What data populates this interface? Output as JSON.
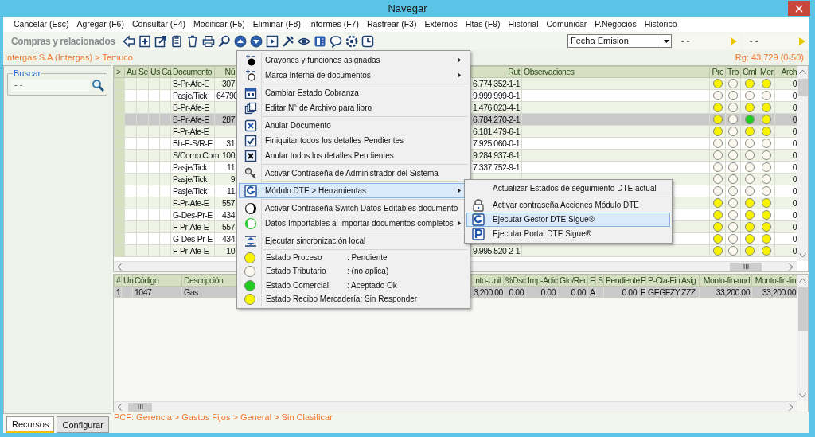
{
  "window": {
    "title": "Navegar"
  },
  "menu_bar": [
    "Cancelar (Esc)",
    "Agregar (F6)",
    "Consultar (F4)",
    "Modificar (F5)",
    "Eliminar (F8)",
    "Informes (F7)",
    "Rastrear (F3)",
    "Externos",
    "Htas (F9)",
    "Historial",
    "Comunicar",
    "P.Negocios",
    "Histórico"
  ],
  "toolbar": {
    "title": "Compras y relacionados",
    "date_field": {
      "value": "Fecha Emision"
    },
    "range_fields": [
      {
        "value": "- -"
      },
      {
        "value": "- -"
      }
    ]
  },
  "breadcrumb": "Intergas S.A (Intergas) > Temuco",
  "record_count": "Rg: 43,729 (0-50)",
  "search": {
    "legend": "Buscar",
    "value": "- -"
  },
  "upper_table": {
    "columns": [
      ">",
      "Au",
      "Se",
      "Us",
      "Ca",
      "Documento",
      "Nú",
      "Rut",
      "Observaciones",
      "Prc",
      "Trb",
      "Cml",
      "Mer",
      "Arch"
    ],
    "rows": [
      {
        "document": "B-Pr-Afe-E",
        "number": "307",
        "rut": "6.774.352-1-1",
        "dots": [
          {
            "color": "#f8f400"
          },
          {
            "color": "#fbf8f0"
          },
          {
            "color": "#f8f400"
          },
          {
            "color": "#f8f400"
          }
        ],
        "arch": "0",
        "selected": false
      },
      {
        "document": "Pasje/Tick",
        "number": "64790",
        "rut": "9.999.999-9-1",
        "dots": [
          {
            "color": "#fbf8f0"
          },
          {
            "color": "#fbf8f0"
          },
          {
            "color": "#fbf8f0"
          },
          {
            "color": "#fbf8f0"
          }
        ],
        "arch": "0",
        "selected": false
      },
      {
        "document": "B-Pr-Afe-E",
        "rut": "1.476.023-4-1",
        "dots": [
          {
            "color": "#f8f400"
          },
          {
            "color": "#fbf8f0"
          },
          {
            "color": "#f8f400"
          },
          {
            "color": "#f8f400"
          }
        ],
        "arch": "0",
        "selected": false
      },
      {
        "document": "B-Pr-Afe-E",
        "number": "287",
        "rut": "6.784.270-2-1",
        "dots": [
          {
            "color": "#f8f400"
          },
          {
            "color": "#fbf8f0"
          },
          {
            "color": "#22cc22"
          },
          {
            "color": "#f8f400"
          }
        ],
        "arch": "0",
        "selected": true
      },
      {
        "document": "F-Pr-Afe-E",
        "rut": "6.181.479-6-1",
        "dots": [
          {
            "color": "#f8f400"
          },
          {
            "color": "#fbf8f0"
          },
          {
            "color": "#f8f400"
          },
          {
            "color": "#f8f400"
          }
        ],
        "arch": "0",
        "selected": false
      },
      {
        "document": "Bh-E-S/R-E",
        "number": "31",
        "rut": "7.925.060-0-1",
        "dots": [
          {
            "color": "#fbf8f0"
          },
          {
            "color": "#fbf8f0"
          },
          {
            "color": "#fbf8f0"
          },
          {
            "color": "#fbf8f0"
          }
        ],
        "arch": "0",
        "selected": false
      },
      {
        "document": "S/Comp Com",
        "number": "100",
        "rut": "9.284.937-6-1",
        "dots": [
          {
            "color": "#fbf8f0"
          },
          {
            "color": "#fbf8f0"
          },
          {
            "color": "#fbf8f0"
          },
          {
            "color": "#fbf8f0"
          }
        ],
        "arch": "0",
        "selected": false
      },
      {
        "document": "Pasje/Tick",
        "number": "11",
        "rut": "7.337.752-9-1",
        "dots": [
          {
            "color": "#fbf8f0"
          },
          {
            "color": "#fbf8f0"
          },
          {
            "color": "#fbf8f0"
          },
          {
            "color": "#fbf8f0"
          }
        ],
        "arch": "0",
        "selected": false
      },
      {
        "document": "Pasje/Tick",
        "number": "9",
        "dots": [
          {
            "color": "#fbf8f0"
          },
          {
            "color": "#fbf8f0"
          },
          {
            "color": "#fbf8f0"
          },
          {
            "color": "#fbf8f0"
          }
        ],
        "arch": "0",
        "selected": false
      },
      {
        "document": "Pasje/Tick",
        "number": "11",
        "dots": [
          {
            "color": "#fbf8f0"
          },
          {
            "color": "#fbf8f0"
          },
          {
            "color": "#fbf8f0"
          },
          {
            "color": "#fbf8f0"
          }
        ],
        "arch": "0",
        "selected": false
      },
      {
        "document": "F-Pr-Afe-E",
        "number": "557",
        "dots": [
          {
            "color": "#f8f400"
          },
          {
            "color": "#fbf8f0"
          },
          {
            "color": "#f8f400"
          },
          {
            "color": "#f8f400"
          }
        ],
        "arch": "0",
        "selected": false
      },
      {
        "document": "G-Des-Pr-E",
        "number": "434",
        "dots": [
          {
            "color": "#f8f400"
          },
          {
            "color": "#fbf8f0"
          },
          {
            "color": "#f8f400"
          },
          {
            "color": "#f8f400"
          }
        ],
        "arch": "0",
        "selected": false
      },
      {
        "document": "F-Pr-Afe-E",
        "number": "557",
        "dots": [
          {
            "color": "#f8f400"
          },
          {
            "color": "#fbf8f0"
          },
          {
            "color": "#f8f400"
          },
          {
            "color": "#f8f400"
          }
        ],
        "arch": "0",
        "selected": false
      },
      {
        "document": "G-Des-Pr-E",
        "number": "434",
        "dots": [
          {
            "color": "#f8f400"
          },
          {
            "color": "#fbf8f0"
          },
          {
            "color": "#f8f400"
          },
          {
            "color": "#f8f400"
          }
        ],
        "arch": "0",
        "selected": false
      },
      {
        "document": "F-Pr-Afe-E",
        "number": "10",
        "rut": "9.995.520-2-1",
        "dots": [
          {
            "color": "#f8f400"
          },
          {
            "color": "#fbf8f0"
          },
          {
            "color": "#f8f400"
          },
          {
            "color": "#f8f400"
          }
        ],
        "arch": "0",
        "selected": false
      }
    ]
  },
  "lower_table": {
    "columns": [
      "#",
      "Un",
      "Código",
      "Descripción",
      "nto-Unit",
      "%Dsc",
      "Imp-Adic",
      "Gto/Rec",
      "E",
      "S",
      "Pendiente",
      "E.",
      "P-Cta-Fin",
      "Asig",
      "Monto-fin-und",
      "Monto-fin-lin"
    ],
    "rows": [
      {
        "cells": [
          "1",
          null,
          "1047",
          "Gas",
          "3,200.00",
          "0.00",
          "0.00",
          "0.00",
          "A",
          null,
          "0.00",
          "F",
          "GEGFZY",
          "ZZZ",
          "33,200.00",
          "33,200.00"
        ],
        "selected": true
      }
    ]
  },
  "pcf_path": "PCF: Gerencia > Gastos Fijos > General > Sin Clasificar",
  "bottom_tabs": [
    {
      "label": "Recursos",
      "selected": true
    },
    {
      "label": "Configurar",
      "selected": false
    }
  ],
  "context_menu": {
    "groups": [
      [
        {
          "label": "Crayones y funciones asignadas",
          "has_submenu": true,
          "selected": false
        },
        {
          "label": "Marca Interna de documentos",
          "has_submenu": true,
          "selected": false
        }
      ],
      [
        {
          "label": "Cambiar Estado Cobranza",
          "has_submenu": false,
          "selected": false
        },
        {
          "label": "Editar N° de Archivo para libro",
          "has_submenu": false,
          "selected": false
        }
      ],
      [
        {
          "label": "Anular Documento",
          "has_submenu": false,
          "selected": false
        },
        {
          "label": "Finiquitar todos los detalles Pendientes",
          "has_submenu": false,
          "selected": false
        },
        {
          "label": "Anular todos los detalles Pendientes",
          "has_submenu": false,
          "selected": false
        }
      ],
      [
        {
          "label": "Activar Contraseña de Administrador del Sistema",
          "has_submenu": false,
          "selected": false
        }
      ],
      [
        {
          "label": "Módulo DTE > Herramientas",
          "has_submenu": true,
          "selected": true
        }
      ],
      [
        {
          "label": "Activar Contraseña Switch Datos Editables documento",
          "has_submenu": false,
          "selected": false
        },
        {
          "label": "Datos Importables al importar documentos completos",
          "has_submenu": true,
          "selected": false
        }
      ],
      [
        {
          "label": "Ejecutar sincronización local",
          "has_submenu": false,
          "selected": false
        }
      ]
    ],
    "statuses": [
      {
        "label": "Estado Proceso",
        "value": ": Pendiente",
        "color": "#f8f400"
      },
      {
        "label": "Estado Tributario",
        "value": ": (no aplica)",
        "color": "#fbf8f0"
      },
      {
        "label": "Estado Comercial",
        "value": ": Aceptado Ok",
        "color": "#22cc22"
      },
      {
        "label": "Estado Recibo Mercadería",
        "value": ": Sin Responder",
        "color": "#f8f400"
      }
    ]
  },
  "submenu": {
    "groups": [
      [
        {
          "label": "Actualizar Estados de seguimiento DTE actual",
          "selected": false
        }
      ],
      [
        {
          "label": "Activar contraseña Acciones Módulo DTE",
          "selected": false
        },
        {
          "label": "Ejecutar Gestor DTE Sigue®",
          "selected": true
        },
        {
          "label": "Ejecutar Portal DTE Sigue®",
          "selected": false
        }
      ]
    ]
  }
}
